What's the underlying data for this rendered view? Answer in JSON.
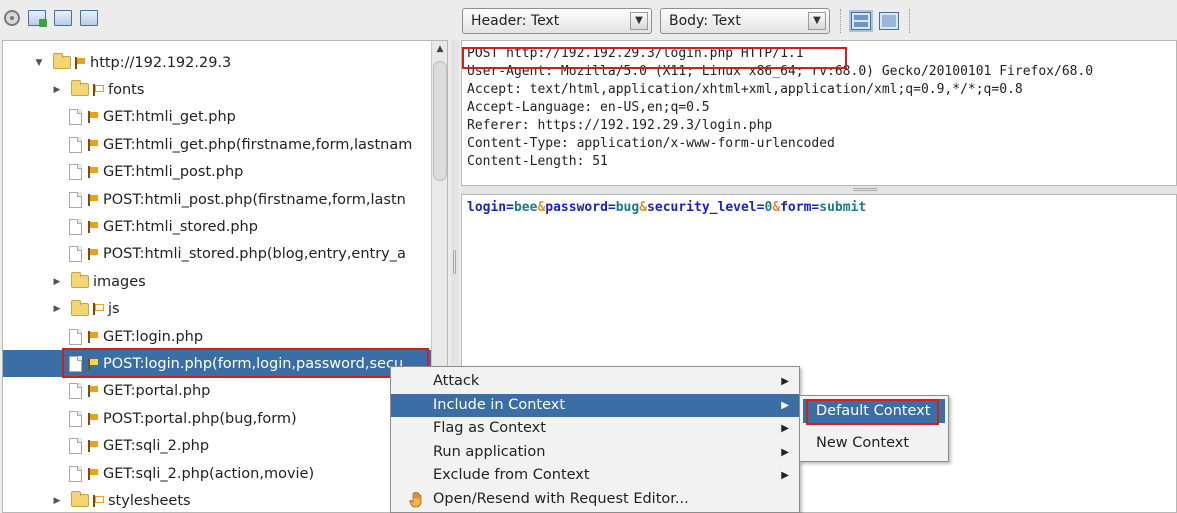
{
  "left_toolbar": {
    "icons": [
      "target-circle-icon",
      "new-context-icon",
      "import-icon",
      "export-icon"
    ]
  },
  "tree": {
    "items": [
      {
        "label": "http://192.192.29.3",
        "type": "site",
        "expanded": true,
        "flag": "filled"
      },
      {
        "label": "fonts",
        "type": "folder",
        "expanded": false,
        "flag": "outline"
      },
      {
        "label": "GET:htmli_get.php",
        "type": "file",
        "flag": "filled"
      },
      {
        "label": "GET:htmli_get.php(firstname,form,lastnam",
        "type": "file",
        "flag": "filled"
      },
      {
        "label": "GET:htmli_post.php",
        "type": "file",
        "flag": "filled"
      },
      {
        "label": "POST:htmli_post.php(firstname,form,lastn",
        "type": "file",
        "flag": "filled"
      },
      {
        "label": "GET:htmli_stored.php",
        "type": "file",
        "flag": "filled"
      },
      {
        "label": "POST:htmli_stored.php(blog,entry,entry_a",
        "type": "file",
        "flag": "filled"
      },
      {
        "label": "images",
        "type": "folder",
        "expanded": false,
        "flag": "none"
      },
      {
        "label": "js",
        "type": "folder",
        "expanded": false,
        "flag": "outline"
      },
      {
        "label": "GET:login.php",
        "type": "file",
        "flag": "filled"
      },
      {
        "label": "POST:login.php(form,login,password,secu",
        "type": "file",
        "flag": "filled",
        "selected": true
      },
      {
        "label": "GET:portal.php",
        "type": "file",
        "flag": "filled"
      },
      {
        "label": "POST:portal.php(bug,form)",
        "type": "file",
        "flag": "filled"
      },
      {
        "label": "GET:sqli_2.php",
        "type": "file",
        "flag": "filled"
      },
      {
        "label": "GET:sqli_2.php(action,movie)",
        "type": "file",
        "flag": "filled"
      },
      {
        "label": "stylesheets",
        "type": "folder",
        "expanded": false,
        "flag": "outline"
      }
    ]
  },
  "right_toolbar": {
    "header_view": "Header: Text",
    "body_view": "Body: Text"
  },
  "request_header": {
    "lines": [
      "POST http://192.192.29.3/login.php HTTP/1.1",
      "User-Agent: Mozilla/5.0 (X11; Linux x86_64; rv:68.0) Gecko/20100101 Firefox/68.0",
      "Accept: text/html,application/xhtml+xml,application/xml;q=0.9,*/*;q=0.8",
      "Accept-Language: en-US,en;q=0.5",
      "Referer: https://192.192.29.3/login.php",
      "Content-Type: application/x-www-form-urlencoded",
      "Content-Length: 51"
    ]
  },
  "request_body": {
    "params": [
      {
        "key": "login",
        "value": "bee"
      },
      {
        "key": "password",
        "value": "bug"
      },
      {
        "key": "security_level",
        "value": "0"
      },
      {
        "key": "form",
        "value": "submit"
      }
    ],
    "separator": "&"
  },
  "context_menu": {
    "items": [
      {
        "label": "Attack",
        "submenu": true
      },
      {
        "label": "Include in Context",
        "submenu": true,
        "active": true
      },
      {
        "label": "Flag as Context",
        "submenu": true
      },
      {
        "label": "Run application",
        "submenu": true
      },
      {
        "label": "Exclude from Context",
        "submenu": true
      },
      {
        "label": "Open/Resend with Request Editor...",
        "submenu": false,
        "icon": "hand-icon"
      }
    ]
  },
  "submenu": {
    "items": [
      {
        "label": "Default Context",
        "active": true
      },
      {
        "label": "New Context"
      }
    ]
  },
  "colors": {
    "selection": "#3b6ea5",
    "highlight_box": "#d41e1e",
    "body_key": "#1a23c7",
    "body_value": "#1a7e87",
    "body_separator": "#d9972d"
  }
}
